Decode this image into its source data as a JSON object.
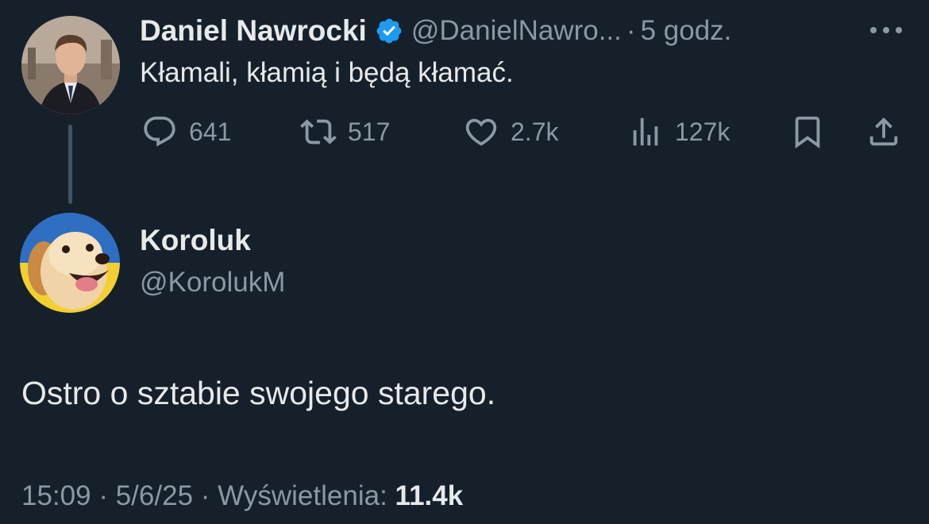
{
  "parent_tweet": {
    "author_name": "Daniel Nawrocki",
    "handle": "@DanielNawro...",
    "separator": "·",
    "time_ago": "5 godz.",
    "text": "Kłamali, kłamią i będą kłamać.",
    "verified": true,
    "stats": {
      "replies": "641",
      "retweets": "517",
      "likes": "2.7k",
      "views": "127k"
    },
    "icons": [
      "verified-badge-icon",
      "more-icon",
      "reply-icon",
      "retweet-icon",
      "like-icon",
      "views-icon",
      "bookmark-icon",
      "share-icon"
    ]
  },
  "main_tweet": {
    "author_name": "Koroluk",
    "handle": "@KorolukM",
    "text": "Ostro o sztabie swojego starego.",
    "meta": {
      "time": "15:09",
      "separator": "·",
      "date": "5/6/25",
      "views_label": "Wyświetlenia:",
      "views_count": "11.4k"
    }
  },
  "colors": {
    "background": "#15202b",
    "primary_text": "#e7e9ea",
    "secondary_text": "#8b98a5",
    "verified_blue": "#1d9bf0",
    "thread_line": "#425364"
  }
}
